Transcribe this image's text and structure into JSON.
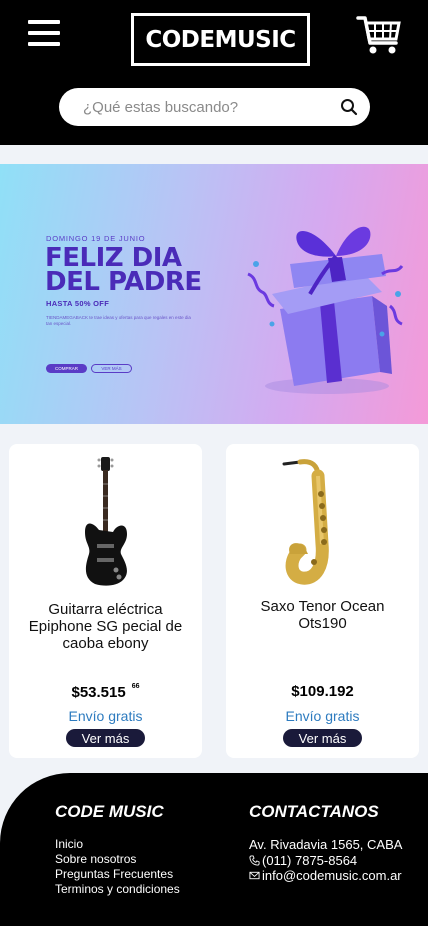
{
  "header": {
    "logo_text": "CODEMUSIC",
    "menu_icon": "hamburger-icon",
    "cart_icon": "shopping-cart-icon",
    "search": {
      "placeholder": "¿Qué estas buscando?",
      "icon": "search-icon"
    }
  },
  "banner": {
    "date": "DOMINGO 19 DE JUNIO",
    "title_line1": "FELIZ DIA",
    "title_line2": "DEL PADRE",
    "subtitle": "HASTA 50% OFF",
    "description": "TIENDAMEGABACK te trae ideas y ofertas para que regales en este dia tan especial.",
    "button_primary": "COMPRAR",
    "button_secondary": "VER MÁS",
    "image_icon": "gift-box-icon"
  },
  "products": [
    {
      "name": "Guitarra eléctrica Epiphone SG pecial de caoba ebony",
      "price": "$53.515",
      "price_cents": "66",
      "shipping": "Envío gratis",
      "button": "Ver más",
      "image_icon": "electric-guitar-icon"
    },
    {
      "name": "Saxo Tenor Ocean Ots190",
      "price": "$109.192",
      "price_cents": "",
      "shipping": "Envío gratis",
      "button": "Ver más",
      "image_icon": "saxophone-icon"
    }
  ],
  "footer": {
    "brand_heading": "CODE MUSIC",
    "links": [
      "Inicio",
      "Sobre nosotros",
      "Preguntas Frecuentes",
      "Terminos y condiciones"
    ],
    "contact_heading": "CONTACTANOS",
    "address": "Av. Rivadavia 1565, CABA",
    "phone": "(011) 7875-8564",
    "email": "info@codemusic.com.ar",
    "phone_icon": "phone-icon",
    "email_icon": "envelope-icon"
  },
  "colors": {
    "header_bg": "#000000",
    "banner_purple": "#4a2bb8",
    "shipping_blue": "#2d7bbf",
    "button_dark": "#1a1a3a",
    "page_bg": "#f0f3f8"
  }
}
